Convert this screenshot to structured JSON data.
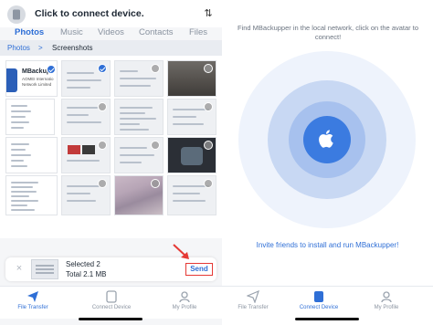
{
  "left": {
    "header": {
      "title": "Click to connect device.",
      "sort_icon": "sort-arrows-icon"
    },
    "tabs": [
      {
        "label": "Photos",
        "active": true
      },
      {
        "label": "Music",
        "active": false
      },
      {
        "label": "Videos",
        "active": false
      },
      {
        "label": "Contacts",
        "active": false
      },
      {
        "label": "Files",
        "active": false
      }
    ],
    "breadcrumb": {
      "root": "Photos",
      "separator": ">",
      "current": "Screenshots"
    },
    "thumbnails": {
      "mbackupper": {
        "name": "MBackup",
        "sub1": "AOMEI Internatio",
        "sub2": "Network Limited"
      }
    },
    "selection": {
      "title": "Selected 2",
      "total": "Total 2.1 MB",
      "send_label": "Send",
      "close": "×"
    },
    "bottom_nav": [
      {
        "label": "File Transfer",
        "active": true,
        "icon": "paper-plane-icon"
      },
      {
        "label": "Connect Device",
        "active": false,
        "icon": "device-icon"
      },
      {
        "label": "My Profile",
        "active": false,
        "icon": "person-icon"
      }
    ]
  },
  "right": {
    "hint": "Find MBackupper in the local network, click on the avatar to connect!",
    "invite": "Invite friends to install and run MBackupper!",
    "bottom_nav": [
      {
        "label": "File Transfer",
        "active": false,
        "icon": "paper-plane-icon"
      },
      {
        "label": "Connect Device",
        "active": true,
        "icon": "device-icon"
      },
      {
        "label": "My Profile",
        "active": false,
        "icon": "person-icon"
      }
    ]
  },
  "colors": {
    "accent": "#2f6fd6",
    "highlight": "#e53935"
  }
}
